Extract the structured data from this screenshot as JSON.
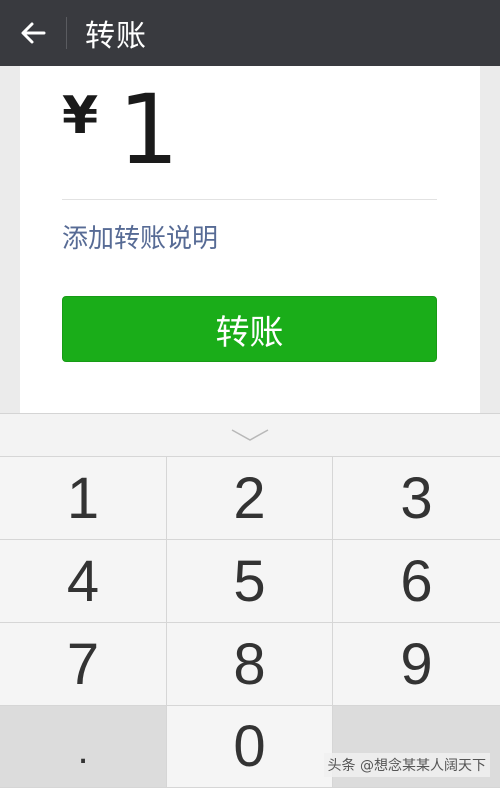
{
  "header": {
    "title": "转账"
  },
  "amount": {
    "currency": "¥",
    "value": "1"
  },
  "note_link": "添加转账说明",
  "confirm_label": "转账",
  "keypad": {
    "keys": [
      "1",
      "2",
      "3",
      "4",
      "5",
      "6",
      "7",
      "8",
      "9",
      ".",
      "0",
      ""
    ]
  },
  "watermark": "头条 @想念某某人阔天下",
  "colors": {
    "header_bg": "#393a3f",
    "button_green": "#1aad19",
    "link_blue": "#576b95"
  }
}
